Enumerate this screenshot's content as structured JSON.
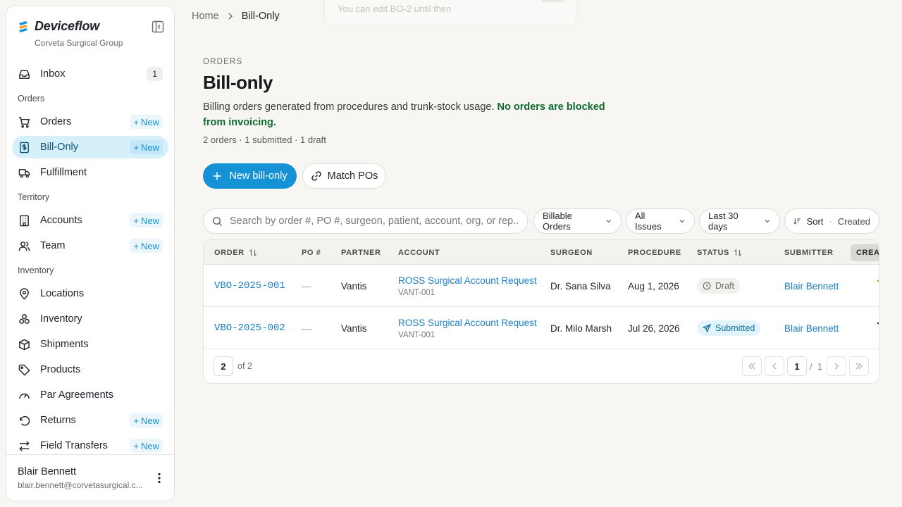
{
  "brand": {
    "name": "Deviceflow",
    "org": "Corveta Surgical Group"
  },
  "sidebar": {
    "inbox": {
      "label": "Inbox",
      "count": "1"
    },
    "sections": {
      "orders": "Orders",
      "territory": "Territory",
      "inventory": "Inventory"
    },
    "new_label": "New",
    "items": {
      "orders": "Orders",
      "bill_only": "Bill-Only",
      "fulfillment": "Fulfillment",
      "accounts": "Accounts",
      "team": "Team",
      "locations": "Locations",
      "inventory": "Inventory",
      "shipments": "Shipments",
      "products": "Products",
      "par_agreements": "Par Agreements",
      "returns": "Returns",
      "field_transfers": "Field Transfers"
    },
    "user": {
      "name": "Blair Bennett",
      "email": "blair.bennett@corvetasurgical.c..."
    }
  },
  "breadcrumb": {
    "home": "Home",
    "current": "Bill-Only"
  },
  "toast": {
    "text": "You can edit BO-2 until then"
  },
  "header": {
    "overline": "ORDERS",
    "title": "Bill-only",
    "description": "Billing orders generated from procedures and trunk-stock usage.",
    "description_ok": "No orders are blocked from invoicing.",
    "stats": "2 orders · 1 submitted · 1 draft"
  },
  "actions": {
    "new_bill_only": "New bill-only",
    "match_pos": "Match POs"
  },
  "filters": {
    "search_placeholder": "Search by order #, PO #, surgeon, patient, account, org, or rep...",
    "billable": "Billable Orders",
    "issues": "All Issues",
    "range": "Last 30 days",
    "sort_label": "Sort",
    "sort_sep": "·",
    "sort_value": "Created"
  },
  "table": {
    "columns": {
      "order": "ORDER",
      "po": "PO #",
      "partner": "PARTNER",
      "account": "ACCOUNT",
      "surgeon": "SURGEON",
      "procedure": "PROCEDURE",
      "status": "STATUS",
      "submitter": "SUBMITTER",
      "created": "CREAT"
    },
    "rows": [
      {
        "order": "VBO-2025-001",
        "po": "—",
        "partner": "Vantis",
        "account_name": "ROSS Surgical Account Request",
        "account_code": "VANT-001",
        "surgeon": "Dr. Sana Silva",
        "procedure": "Aug 1, 2026",
        "status": "Draft",
        "submitter": "Blair Bennett"
      },
      {
        "order": "VBO-2025-002",
        "po": "—",
        "partner": "Vantis",
        "account_name": "ROSS Surgical Account Request",
        "account_code": "VANT-001",
        "surgeon": "Dr. Milo Marsh",
        "procedure": "Jul 26, 2026",
        "status": "Submitted",
        "submitter": "Blair Bennett"
      }
    ],
    "footer": {
      "page_size": "2",
      "of_total": "of 2",
      "current_page": "1",
      "page_sep": "/",
      "total_pages": "1"
    }
  },
  "colors": {
    "accent": "#1591d5",
    "ok": "#0d6b2f",
    "active_nav": "#d6f0fb"
  }
}
